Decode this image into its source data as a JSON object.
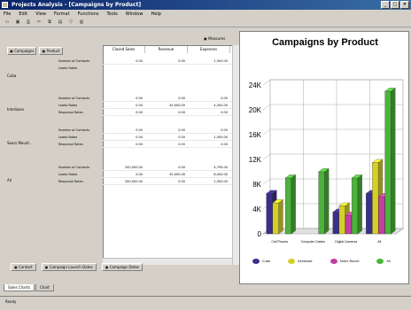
{
  "window": {
    "title": "Projects Analysis - [Campaigns by Product]",
    "minimize": "_",
    "maximize": "□",
    "close": "×"
  },
  "menus": [
    "File",
    "Edit",
    "View",
    "Format",
    "Functions",
    "Tools",
    "Window",
    "Help"
  ],
  "toolbar": {
    "icons": [
      "new-icon",
      "save-icon",
      "print-icon",
      "cut-icon",
      "copy-icon",
      "paste-icon",
      "filter-icon",
      "chart-icon"
    ]
  },
  "table": {
    "measures_label": "Measures",
    "dimensions": [
      "Campaigns",
      "Product"
    ],
    "columns": [
      "Closed Sales",
      "Revenue",
      "Expenses"
    ],
    "groups": [
      {
        "name": "Cuba",
        "metrics": [
          "Number of Contacts",
          "Leads Rates"
        ],
        "rows": [
          [
            "0.00",
            "0.00",
            "1,500.00"
          ],
          [
            "",
            "",
            ""
          ]
        ]
      },
      {
        "name": "Interbase",
        "metrics": [
          "Number of Contacts",
          "Leads Rates",
          "Response Rates"
        ],
        "rows": [
          [
            "0.00",
            "0.00",
            "0.00"
          ],
          [
            "0.00",
            "45,000.00",
            "4,500.00"
          ],
          [
            "0.00",
            "0.00",
            "0.00"
          ]
        ]
      },
      {
        "name": "Sears Mount...",
        "metrics": [
          "Number of Contacts",
          "Leads Rates",
          "Response Rates"
        ],
        "rows": [
          [
            "0.00",
            "0.00",
            "0.00"
          ],
          [
            "0.00",
            "0.00",
            "1,500.00"
          ],
          [
            "0.00",
            "0.00",
            "0.00"
          ]
        ]
      },
      {
        "name": "All",
        "metrics": [
          "Number of Contacts",
          "Leads Rates",
          "Response Rates"
        ],
        "rows": [
          [
            "200,000.00",
            "0.00",
            "4,795.00"
          ],
          [
            "0.00",
            "45,000.00",
            "6,000.00"
          ],
          [
            "200,000.00",
            "0.00",
            "1,500.00"
          ]
        ]
      }
    ],
    "bottom_buttons": [
      "Contact",
      "Campaign Launch Dates",
      "Campaign Dates"
    ]
  },
  "sheet_tabs": [
    "Sales Charts",
    "Chart"
  ],
  "statusbar": {
    "text": "Ready"
  },
  "chart_data": {
    "type": "bar",
    "title": "Campaigns by Product",
    "ylim": [
      0,
      24000
    ],
    "yticks": [
      "0",
      "4K",
      "8K",
      "12K",
      "16K",
      "20K",
      "24K"
    ],
    "categories": [
      "Cell Phones",
      "Computer Cables",
      "Digital Cameras",
      "All"
    ],
    "series": [
      {
        "name": "Cuba",
        "values": [
          6500,
          0,
          3500,
          6500
        ],
        "color": "#3a2f8c"
      },
      {
        "name": "Interbase",
        "values": [
          5000,
          0,
          4500,
          11500
        ],
        "color": "#d6cf2a"
      },
      {
        "name": "Sears Mount",
        "values": [
          0,
          0,
          3000,
          6000
        ],
        "color": "#c43fa0"
      },
      {
        "name": "All",
        "values": [
          9000,
          10000,
          9000,
          23000
        ],
        "color": "#4bb33a"
      }
    ],
    "grid": true,
    "legend": "bottom"
  }
}
